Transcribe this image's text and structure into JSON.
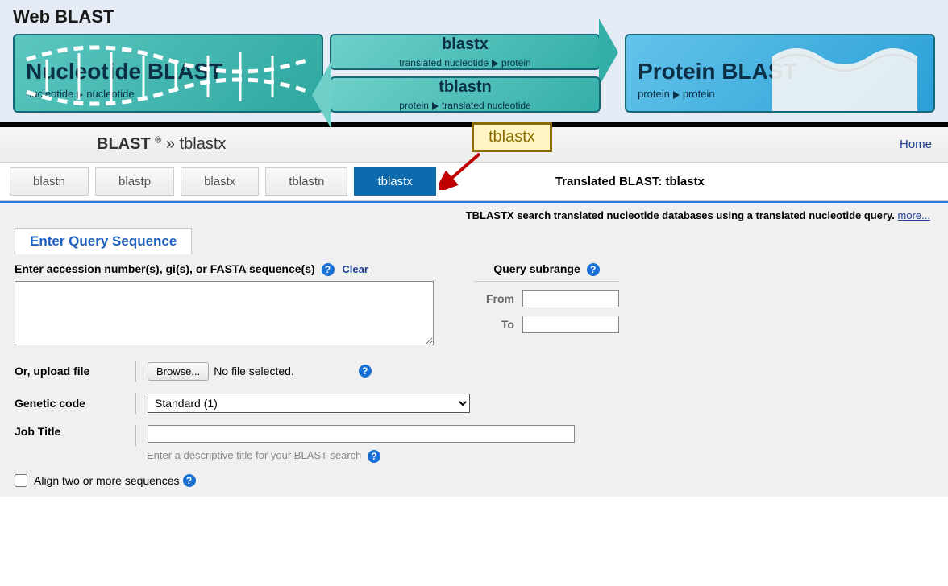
{
  "top": {
    "title": "Web BLAST",
    "nucleotide": {
      "title": "Nucleotide BLAST",
      "sub_a": "nucleotide",
      "sub_b": "nucleotide"
    },
    "blastx": {
      "title": "blastx",
      "sub_a": "translated nucleotide",
      "sub_b": "protein"
    },
    "tblastn": {
      "title": "tblastn",
      "sub_a": "protein",
      "sub_b": "translated nucleotide"
    },
    "protein": {
      "title": "Protein BLAST",
      "sub_a": "protein",
      "sub_b": "protein"
    }
  },
  "crumb": {
    "brand": "BLAST",
    "reg": "®",
    "sep": "»",
    "current": "tblastx",
    "home": "Home"
  },
  "annotation": "tblastx",
  "tabs": {
    "items": [
      "blastn",
      "blastp",
      "blastx",
      "tblastn",
      "tblastx"
    ],
    "right_label": "Translated BLAST: tblastx"
  },
  "desc": {
    "text": "TBLASTX search translated nucleotide databases using a translated nucleotide query.",
    "more": "more..."
  },
  "section_title": "Enter Query Sequence",
  "form": {
    "seq_label": "Enter accession number(s), gi(s), or FASTA sequence(s)",
    "clear": "Clear",
    "subrange": {
      "title": "Query subrange",
      "from": "From",
      "to": "To"
    },
    "upload": {
      "label": "Or, upload file",
      "button": "Browse...",
      "nofile": "No file selected."
    },
    "genetic": {
      "label": "Genetic code",
      "selected": "Standard (1)"
    },
    "job": {
      "label": "Job Title",
      "hint": "Enter a descriptive title for your BLAST search"
    },
    "align": "Align two or more sequences"
  }
}
